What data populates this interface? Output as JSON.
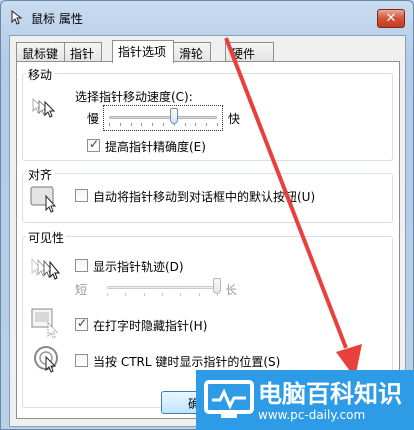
{
  "window": {
    "title": "鼠标 属性",
    "close_label": "✕"
  },
  "tabs": [
    {
      "label": "鼠标键",
      "active": false
    },
    {
      "label": "指针",
      "active": false
    },
    {
      "label": "指针选项",
      "active": true
    },
    {
      "label": "滑轮",
      "active": false
    },
    {
      "label": "硬件",
      "active": false
    }
  ],
  "motion": {
    "title": "移动",
    "speed_label": "选择指针移动速度(C):",
    "slow_label": "慢",
    "fast_label": "快",
    "speed_level": 0.6,
    "precision_label": "提高指针精确度(E)",
    "precision_checked": true
  },
  "snap": {
    "title": "对齐",
    "snap_label": "自动将指针移动到对话框中的默认按钮(U)",
    "snap_checked": false
  },
  "visibility": {
    "title": "可见性",
    "trails_label": "显示指针轨迹(D)",
    "trails_checked": false,
    "short_label": "短",
    "long_label": "长",
    "trails_level": 1.0,
    "hide_label": "在打字时隐藏指针(H)",
    "hide_checked": true,
    "ctrl_label": "当按 CTRL 键时显示指针的位置(S)",
    "ctrl_checked": false
  },
  "footer": {
    "ok_label": "确定"
  },
  "watermark": {
    "title": "电脑百科知识",
    "url": "www.pc-daily.com",
    "color": "#2e9be6"
  },
  "annotation": {
    "arrow_color": "#e8413c"
  }
}
